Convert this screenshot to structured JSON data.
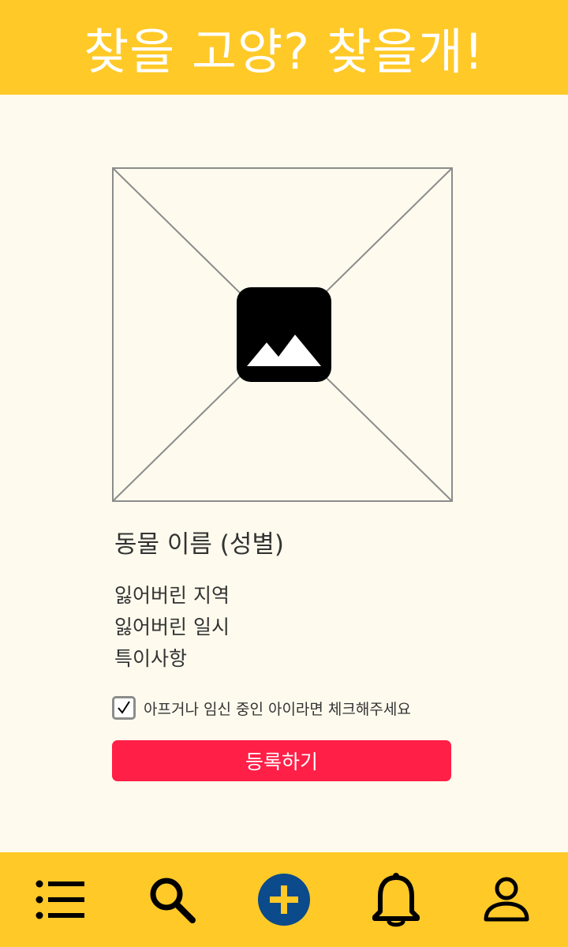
{
  "header": {
    "title": "찾을 고양? 찾을개!"
  },
  "photo": {
    "icon": "image-icon"
  },
  "pet": {
    "name_label": "동물 이름 (성별)",
    "lost_location": "잃어버린 지역",
    "lost_datetime": "잃어버린 일시",
    "notes": "특이사항"
  },
  "special_care": {
    "checked": true,
    "label": "아프거나 임신 중인 아이라면 체크해주세요"
  },
  "register_button": {
    "label": "등록하기"
  },
  "bottom_nav": {
    "items": [
      {
        "icon": "list-icon"
      },
      {
        "icon": "search-icon"
      },
      {
        "icon": "add-icon"
      },
      {
        "icon": "bell-icon"
      },
      {
        "icon": "profile-icon"
      }
    ]
  },
  "colors": {
    "brand_yellow": "#FFC928",
    "background": "#FEFBEE",
    "accent_red": "#FF1F47",
    "nav_add_blue": "#0B4A8B"
  }
}
